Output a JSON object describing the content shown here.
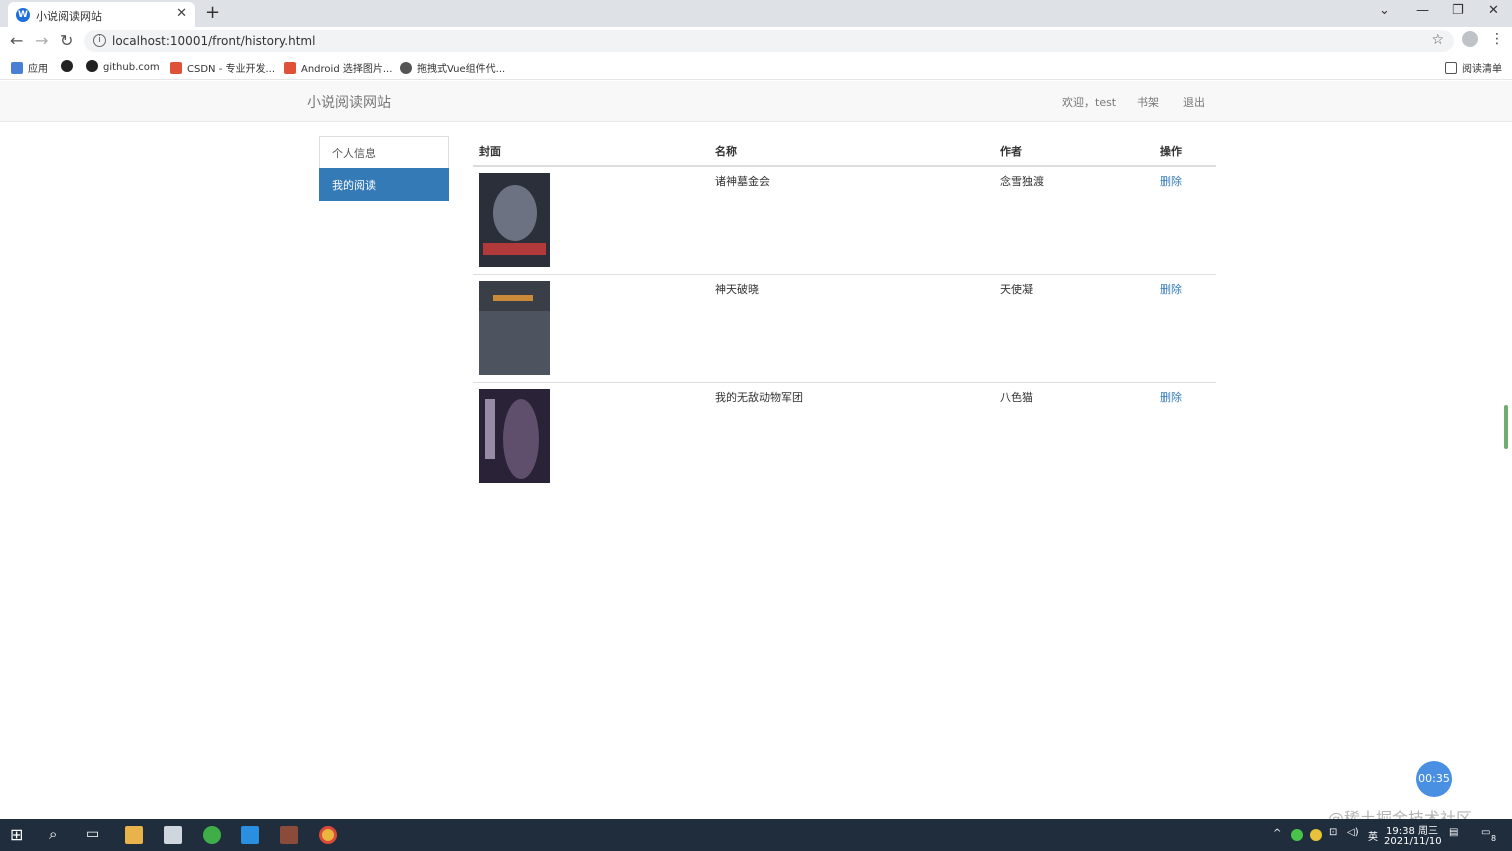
{
  "browser": {
    "tab_title": "小说阅读网站",
    "url": "localhost:10001/front/history.html",
    "bookmarks": [
      "应用",
      "github.com",
      "CSDN - 专业开发...",
      "Android 选择图片...",
      "拖拽式Vue组件代..."
    ],
    "reading_list": "阅读清单"
  },
  "navbar": {
    "brand": "小说阅读网站",
    "welcome": "欢迎，test",
    "bookshelf": "书架",
    "logout": "退出"
  },
  "sidebar": {
    "items": [
      {
        "label": "个人信息",
        "active": false
      },
      {
        "label": "我的阅读",
        "active": true
      }
    ]
  },
  "table": {
    "headers": [
      "封面",
      "名称",
      "作者",
      "操作"
    ],
    "rows": [
      {
        "name": "诸神墓金会",
        "author": "念雪独渡",
        "action": "删除",
        "cover_colors": [
          "#2b2f3a",
          "#8a8fa3",
          "#b33a3a"
        ]
      },
      {
        "name": "神天破晓",
        "author": "天使凝",
        "action": "删除",
        "cover_colors": [
          "#3a3f47",
          "#5b6270",
          "#c98a3a"
        ]
      },
      {
        "name": "我的无敌动物军团",
        "author": "八色猫",
        "action": "删除",
        "cover_colors": [
          "#2a2236",
          "#6d5a7a",
          "#c6b8d6"
        ]
      }
    ]
  },
  "overlay": {
    "timer": "00:35",
    "watermark": "@稀土掘金技术社区"
  },
  "taskbar": {
    "time": "19:38 周三",
    "date": "2021/11/10",
    "lang": "英",
    "notif_count": "8"
  }
}
